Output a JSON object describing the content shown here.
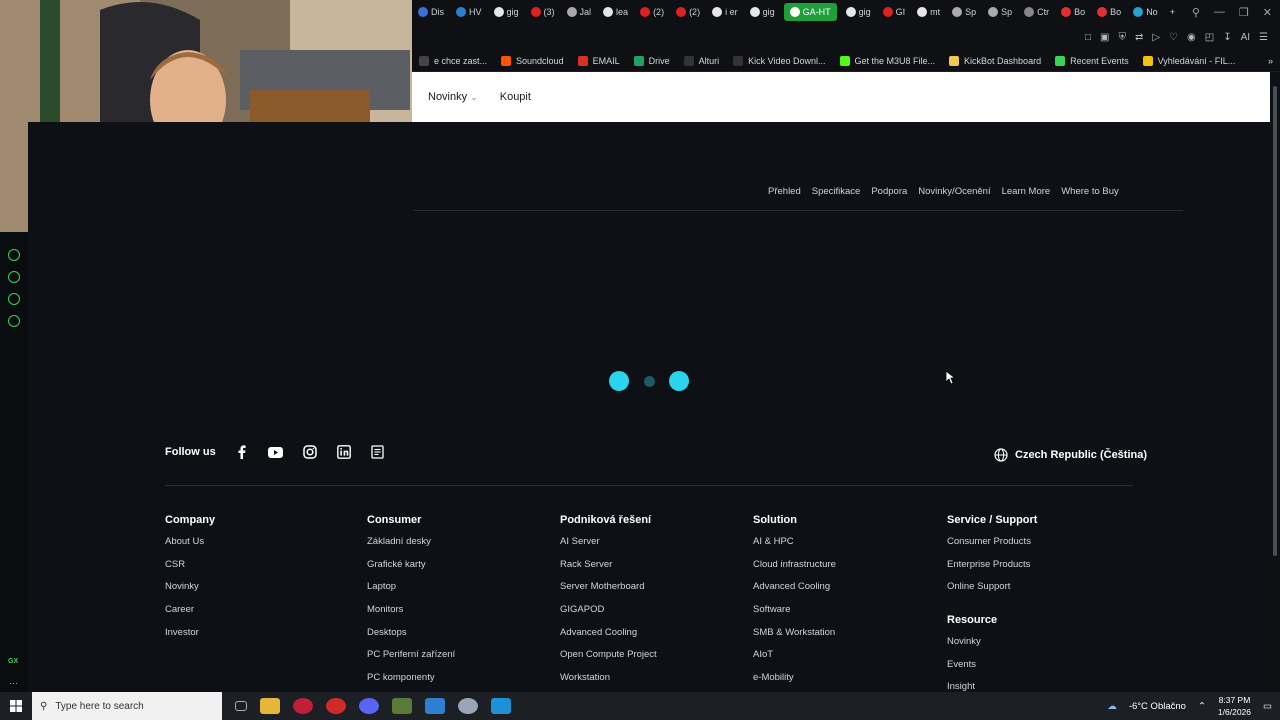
{
  "tabs": [
    {
      "label": "Dis",
      "color": "#3c6fd8"
    },
    {
      "label": "HV",
      "color": "#2a7fd1"
    },
    {
      "label": "gig",
      "color": "#e6e6e6"
    },
    {
      "label": "(3)",
      "color": "#e02020"
    },
    {
      "label": "Jal",
      "color": "#aaaaaa"
    },
    {
      "label": "lea",
      "color": "#e6e6e6"
    },
    {
      "label": "(2)",
      "color": "#e02020"
    },
    {
      "label": "(2)",
      "color": "#e02020"
    },
    {
      "label": "i er",
      "color": "#e6e6e6"
    },
    {
      "label": "gig",
      "color": "#e6e6e6"
    },
    {
      "label": "GA-HT",
      "color": "#ffffff",
      "active": true
    },
    {
      "label": "gig",
      "color": "#e6e6e6"
    },
    {
      "label": "GI",
      "color": "#e02020"
    },
    {
      "label": "mt",
      "color": "#e6e6e6"
    },
    {
      "label": "Sp",
      "color": "#aaaaaa"
    },
    {
      "label": "Sp",
      "color": "#aaaaaa"
    },
    {
      "label": "Ctr",
      "color": "#888888"
    },
    {
      "label": "Bo",
      "color": "#e03030"
    },
    {
      "label": "Bo",
      "color": "#e03030"
    },
    {
      "label": "No",
      "color": "#2a9fd1"
    }
  ],
  "bookmarks": [
    {
      "label": "e chce zast...",
      "color": "#444"
    },
    {
      "label": "Soundcloud",
      "color": "#ff5500"
    },
    {
      "label": "EMAIL",
      "color": "#d93025"
    },
    {
      "label": "Drive",
      "color": "#1fa463"
    },
    {
      "label": "Alturi",
      "color": "#333"
    },
    {
      "label": "Kick Video Downl...",
      "color": "#333"
    },
    {
      "label": "Get the M3U8 File...",
      "color": "#53fc18"
    },
    {
      "label": "KickBot Dashboard",
      "color": "#f2c94c"
    },
    {
      "label": "Recent Events",
      "color": "#3ad35a"
    },
    {
      "label": "Vyhledávání - FIL...",
      "color": "#f4c20d"
    }
  ],
  "toolbar": {
    "ai_label": "AI"
  },
  "navbar": {
    "news": "Novinky",
    "buy": "Koupit"
  },
  "subnav": [
    "Přehled",
    "Specifikace",
    "Podpora",
    "Novinky/Ocenění",
    "Learn More",
    "Where to Buy"
  ],
  "follow": {
    "label": "Follow us",
    "icons": [
      "facebook-icon",
      "youtube-icon",
      "instagram-icon",
      "linkedin-icon",
      "newsletter-icon"
    ]
  },
  "region": {
    "label": "Czech Republic (Čeština)"
  },
  "footer": {
    "company": {
      "title": "Company",
      "links": [
        "About Us",
        "CSR",
        "Novinky",
        "Career",
        "Investor"
      ]
    },
    "consumer": {
      "title": "Consumer",
      "links": [
        "Základní desky",
        "Grafické karty",
        "Laptop",
        "Monitors",
        "Desktops",
        "PC Periferní zařízení",
        "PC komponenty"
      ]
    },
    "enterprise": {
      "title": "Podniková řešení",
      "links": [
        "AI Server",
        "Rack Server",
        "Server Motherboard",
        "GIGAPOD",
        "Advanced Cooling",
        "Open Compute Project",
        "Workstation"
      ]
    },
    "solution": {
      "title": "Solution",
      "links": [
        "AI & HPC",
        "Cloud infrastructure",
        "Advanced Cooling",
        "Software",
        "SMB & Workstation",
        "AIoT",
        "e-Mobility"
      ]
    },
    "service": {
      "title": "Service / Support",
      "links": [
        "Consumer Products",
        "Enterprise Products",
        "Online Support"
      ]
    },
    "resource": {
      "title": "Resource",
      "links": [
        "Novinky",
        "Events",
        "Insight"
      ]
    }
  },
  "taskbar": {
    "search_placeholder": "Type here to search",
    "weather": "-6°C  Oblačno",
    "time": "8:37 PM",
    "date": "1/6/2026",
    "gx_label": "GX"
  },
  "colors": {
    "accent": "#3ad35a",
    "loader": "#2ad4ec",
    "page_bg": "#0d1116"
  }
}
